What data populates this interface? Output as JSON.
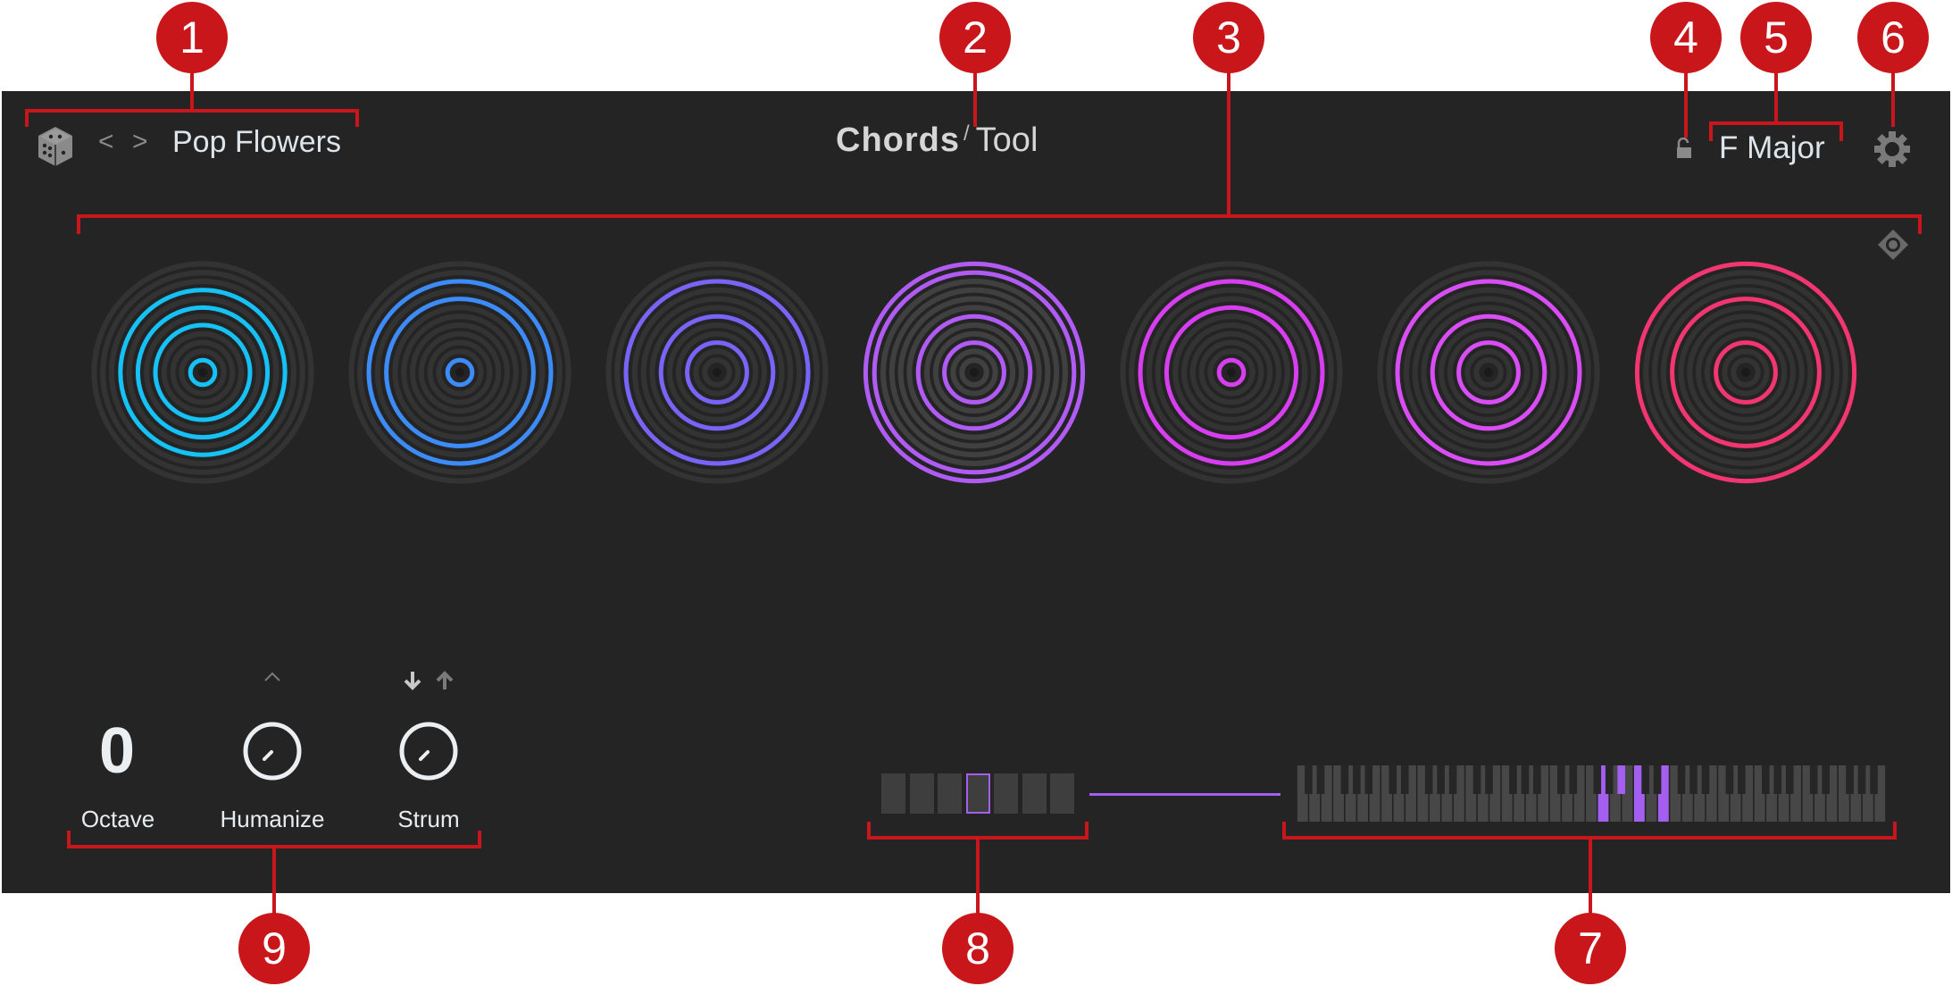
{
  "app": {
    "title_main": "Chords",
    "title_sub": "Tool",
    "preset_name": "Pop Flowers",
    "key": "F Major",
    "icons": {
      "randomize": "dice-icon",
      "prev": "chevron-left-icon",
      "next": "chevron-right-icon",
      "lock": "unlock-icon",
      "settings": "gear-icon",
      "drag": "drag-move-icon"
    },
    "nav_prev_glyph": "<",
    "nav_next_glyph": ">"
  },
  "callouts": [
    "1",
    "2",
    "3",
    "4",
    "5",
    "6",
    "7",
    "8",
    "9"
  ],
  "pads": [
    {
      "color": "#16c2f5",
      "active_rings": [
        1,
        5,
        7,
        9
      ],
      "center_dot": true
    },
    {
      "color": "#3d8bf7",
      "active_rings": [
        1,
        8,
        10
      ],
      "center_dot": true
    },
    {
      "color": "#7865f7",
      "active_rings": [
        3,
        6,
        10
      ],
      "center_dot": false
    },
    {
      "color": "#b05cf4",
      "active_rings": [
        3,
        6,
        11,
        12
      ],
      "center_dot": false,
      "selected": true
    },
    {
      "color": "#d63ef0",
      "active_rings": [
        1,
        7,
        10
      ],
      "center_dot": true
    },
    {
      "color": "#d84ef4",
      "active_rings": [
        3,
        6,
        10
      ],
      "center_dot": false
    },
    {
      "color": "#f23672",
      "active_rings": [
        3,
        8,
        12
      ],
      "center_dot": false
    }
  ],
  "controls": {
    "octave": {
      "label": "Octave",
      "value": "0"
    },
    "humanize": {
      "label": "Humanize",
      "value_fraction": 0.0,
      "extra_icon": "chevron-up-icon"
    },
    "strum": {
      "label": "Strum",
      "value_fraction": 0.0,
      "direction_icons": [
        "arrow-down-icon",
        "arrow-up-icon"
      ],
      "active_direction": "down"
    }
  },
  "chord_slots": {
    "count": 7,
    "selected_index": 3,
    "accent": "#a45ff0"
  },
  "keyboard": {
    "white_keys": 49,
    "highlighted_white": [
      25,
      28,
      30
    ],
    "highlighted_black": [
      19
    ],
    "accent": "#a45ff0"
  }
}
